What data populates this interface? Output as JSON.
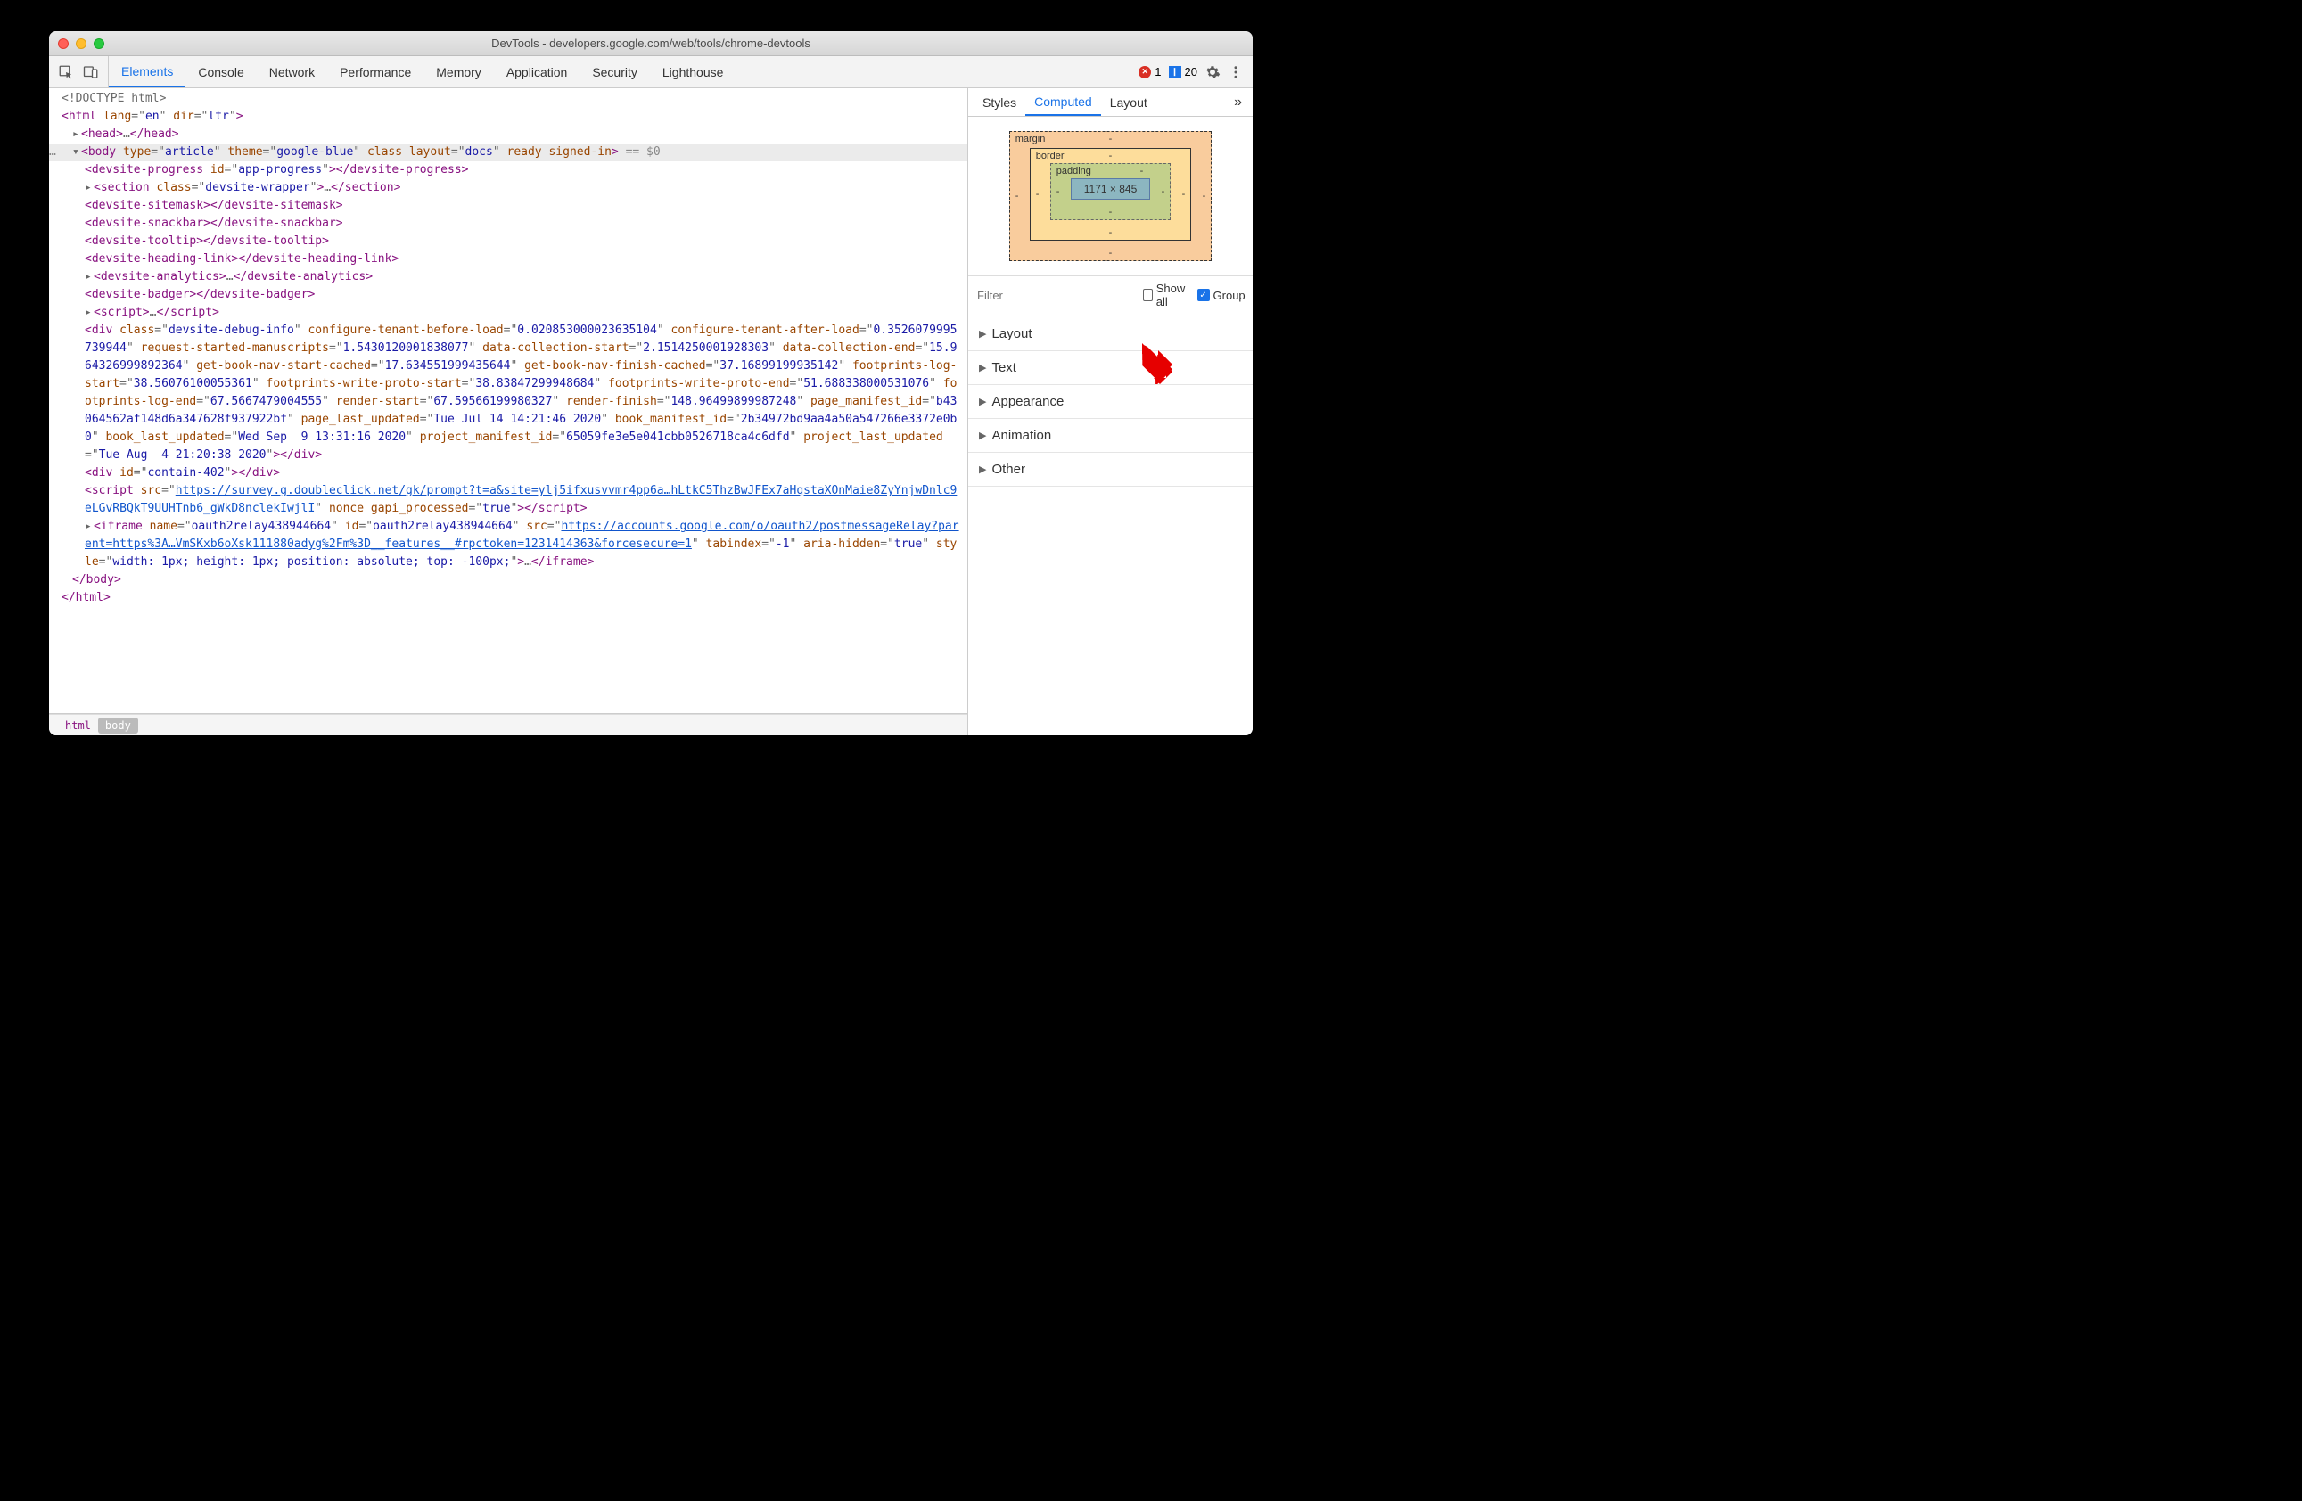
{
  "window": {
    "title": "DevTools - developers.google.com/web/tools/chrome-devtools"
  },
  "toolbar": {
    "tabs": [
      "Elements",
      "Console",
      "Network",
      "Performance",
      "Memory",
      "Application",
      "Security",
      "Lighthouse"
    ],
    "active_tab": "Elements",
    "errors": "1",
    "messages": "20"
  },
  "elements": {
    "doctype": "<!DOCTYPE html>",
    "html_open": {
      "lang": "en",
      "dir": "ltr"
    },
    "head_collapsed": "…",
    "body_line": {
      "type": "article",
      "theme": "google-blue",
      "layout": "docs",
      "trailing_classes": "ready signed-in",
      "eq0": "== $0"
    },
    "progress": {
      "id": "app-progress"
    },
    "section_class": "devsite-wrapper",
    "simple_tags": [
      "devsite-sitemask",
      "devsite-snackbar",
      "devsite-tooltip",
      "devsite-heading-link"
    ],
    "analytics_tag": "devsite-analytics",
    "badger_tag": "devsite-badger",
    "script_collapsed": "…",
    "debug_div": {
      "class": "devsite-debug-info",
      "configure_tenant_before_load": "0.020853000023635104",
      "configure_tenant_after_load": "0.3526079995739944",
      "request_started_manuscripts": "1.5430120001838077",
      "data_collection_start": "2.1514250001928303",
      "data_collection_end": "15.964326999892364",
      "get_book_nav_start_cached": "17.634551999435644",
      "get_book_nav_finish_cached": "37.16899199935142",
      "footprints_log_start": "38.56076100055361",
      "footprints_write_proto_start": "38.83847299948684",
      "footprints_write_proto_end": "51.688338000531076",
      "footprints_log_end": "67.5667479004555",
      "render_start": "67.59566199980327",
      "render_finish": "148.96499899987248",
      "page_manifest_id": "b43064562af148d6a347628f937922bf",
      "page_last_updated": "Tue Jul 14 14:21:46 2020",
      "book_manifest_id": "2b34972bd9aa4a50a547266e3372e0b0",
      "book_last_updated": "Wed Sep  9 13:31:16 2020",
      "project_manifest_id": "65059fe3e5e041cbb0526718ca4c6dfd",
      "project_last_updated": "Tue Aug  4 21:20:38 2020"
    },
    "contain_div_id": "contain-402",
    "survey_script": {
      "src": "https://survey.g.doubleclick.net/gk/prompt?t=a&site=ylj5ifxusvvmr4pp6a…hLtkC5ThzBwJFEx7aHqstaXOnMaie8ZyYnjwDnlc9eLGvRBQkT9UUHTnb6_gWkD8nclekIwjlI",
      "gapi_processed": "true"
    },
    "iframe": {
      "name": "oauth2relay438944664",
      "id": "oauth2relay438944664",
      "src": "https://accounts.google.com/o/oauth2/postmessageRelay?parent=https%3A…VmSKxb6oXsk111880adyg%2Fm%3D__features__#rpctoken=1231414363&forcesecure=1",
      "tabindex": "-1",
      "aria_hidden": "true",
      "style": "width: 1px; height: 1px; position: absolute; top: -100px;"
    }
  },
  "breadcrumbs": [
    "html",
    "body"
  ],
  "sidebar": {
    "tabs": [
      "Styles",
      "Computed",
      "Layout"
    ],
    "active": "Computed",
    "boxmodel": {
      "margin_label": "margin",
      "border_label": "border",
      "padding_label": "padding",
      "content_size": "1171 × 845"
    },
    "filter_placeholder": "Filter",
    "showall_label": "Show all",
    "showall_checked": false,
    "group_label": "Group",
    "group_checked": true,
    "groups": [
      "Layout",
      "Text",
      "Appearance",
      "Animation",
      "Other"
    ]
  }
}
